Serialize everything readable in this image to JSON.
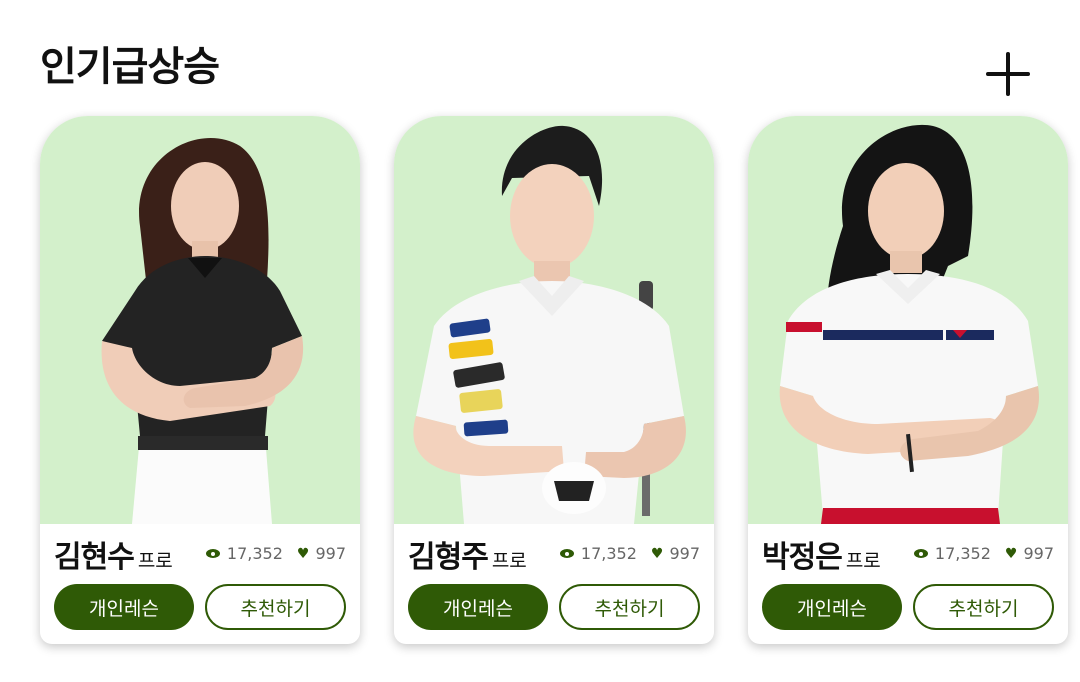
{
  "header": {
    "title": "인기급상승",
    "add_icon": "plus-icon"
  },
  "colors": {
    "accent": "#2f5a06",
    "photo_background": "#d3f0cb"
  },
  "cards": [
    {
      "name": "김현수",
      "suffix": "프로",
      "views": "17,352",
      "likes": "997",
      "primary_button": "개인레슨",
      "secondary_button": "추천하기"
    },
    {
      "name": "김형주",
      "suffix": "프로",
      "views": "17,352",
      "likes": "997",
      "primary_button": "개인레슨",
      "secondary_button": "추천하기"
    },
    {
      "name": "박정은",
      "suffix": "프로",
      "views": "17,352",
      "likes": "997",
      "primary_button": "개인레슨",
      "secondary_button": "추천하기"
    }
  ]
}
